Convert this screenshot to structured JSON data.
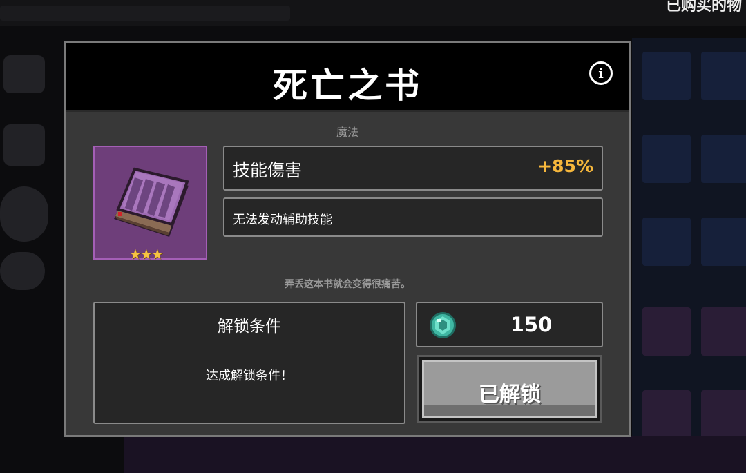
{
  "background": {
    "top_right_text": "已购买的物"
  },
  "item": {
    "name": "死亡之书",
    "category": "魔法",
    "stars": "★★★",
    "stat": {
      "label": "技能傷害",
      "value": "+85%"
    },
    "effect": "无法发动辅助技能",
    "flavor_text": "弄丢这本书就会变得很痛苦。",
    "icon": "purple-spellbook-icon",
    "frame_color": "#6e3e7a"
  },
  "unlock": {
    "title": "解锁条件",
    "description": "达成解锁条件！"
  },
  "price": {
    "currency_icon": "gem-icon",
    "amount": "150"
  },
  "action": {
    "label": "已解锁"
  },
  "colors": {
    "accent_value": "#f6b73c",
    "panel": "#383838",
    "header": "#000000"
  }
}
